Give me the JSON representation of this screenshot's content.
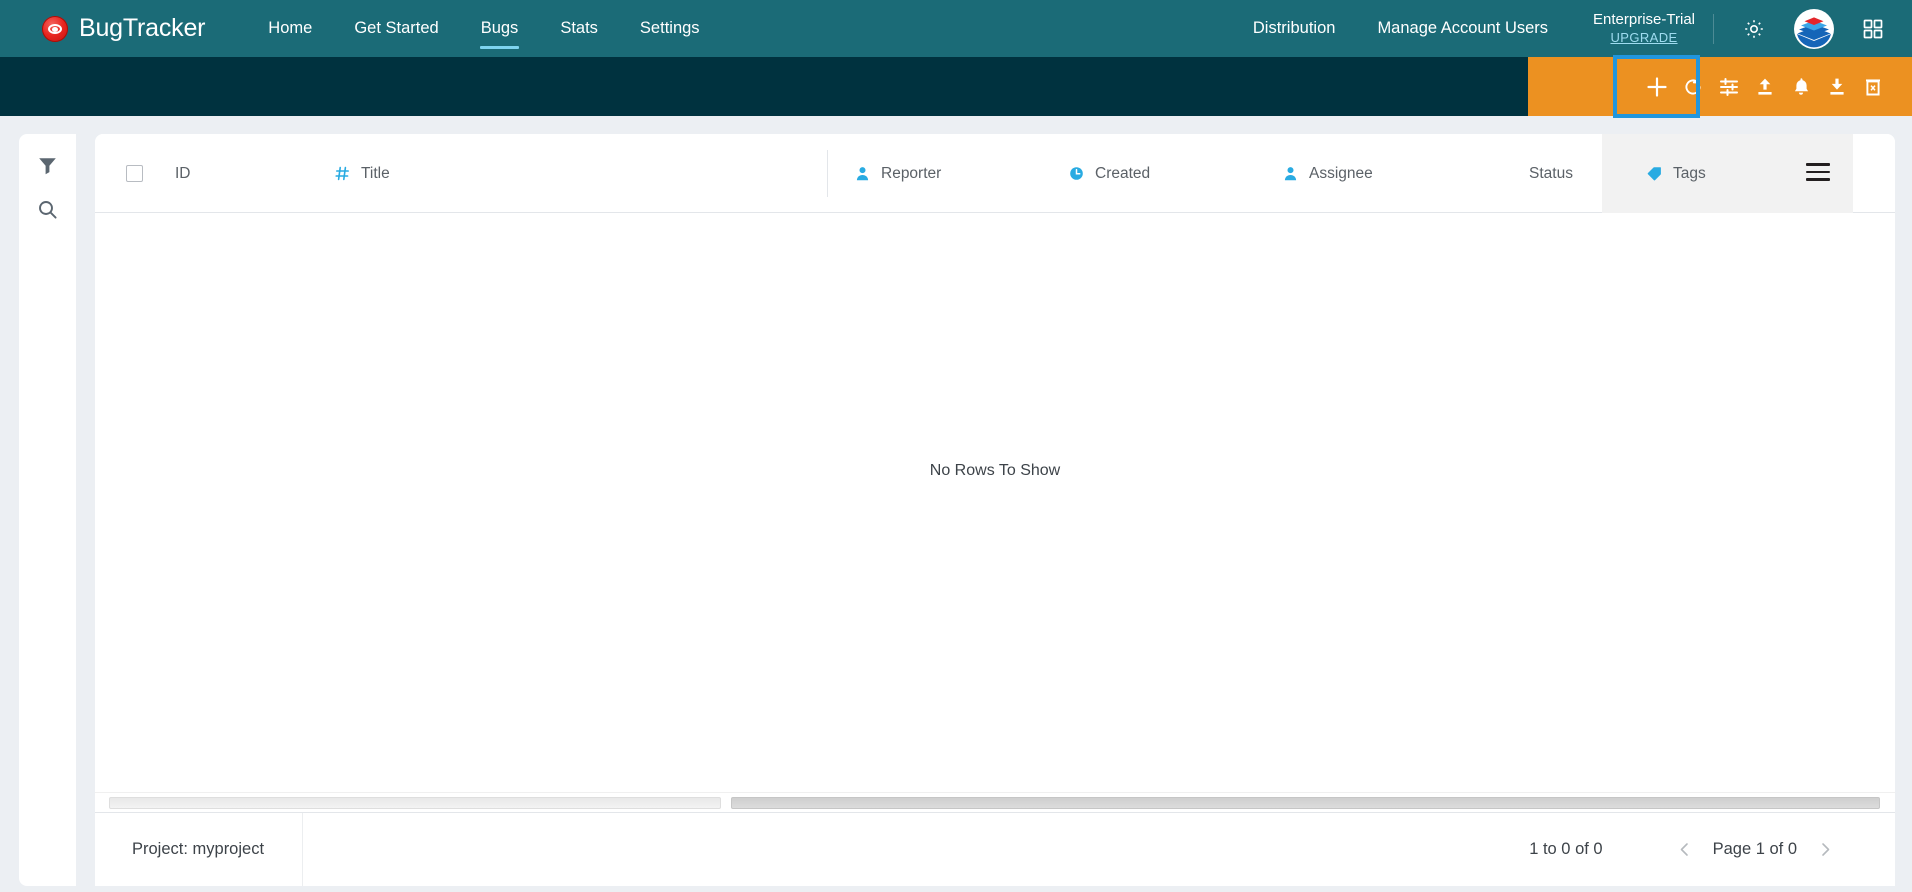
{
  "header": {
    "brand": "BugTracker",
    "logo_icon": "bug-eye-logo",
    "nav": [
      {
        "label": "Home",
        "active": false
      },
      {
        "label": "Get Started",
        "active": false
      },
      {
        "label": "Bugs",
        "active": true
      },
      {
        "label": "Stats",
        "active": false
      },
      {
        "label": "Settings",
        "active": false
      }
    ],
    "nav_right": [
      {
        "label": "Distribution"
      },
      {
        "label": "Manage Account Users"
      }
    ],
    "plan": {
      "name": "Enterprise-Trial",
      "upgrade": "UPGRADE"
    },
    "icons": [
      {
        "name": "gear-icon"
      },
      {
        "name": "stack-diamond-logo-icon"
      },
      {
        "name": "apps-grid-icon"
      }
    ],
    "colors": {
      "nav_bg": "#1b6b77",
      "underline": "#7fd4ef",
      "subbar_bg": "#00323f"
    }
  },
  "toolbar": {
    "bg_color": "#ec9121",
    "highlight_color": "#2196dd",
    "buttons": [
      {
        "name": "add-bug-button",
        "icon": "plus-icon",
        "highlighted": true
      },
      {
        "name": "refresh-button",
        "icon": "refresh-icon",
        "highlighted": false
      },
      {
        "name": "column-settings-button",
        "icon": "sliders-icon",
        "highlighted": false
      },
      {
        "name": "upload-button",
        "icon": "upload-icon",
        "highlighted": false
      },
      {
        "name": "notifications-button",
        "icon": "bell-icon",
        "highlighted": false
      },
      {
        "name": "download-button",
        "icon": "download-icon",
        "highlighted": false
      },
      {
        "name": "delete-button",
        "icon": "trash-icon",
        "highlighted": false
      }
    ]
  },
  "left_rail": {
    "items": [
      {
        "name": "filter-tool",
        "icon": "funnel-icon"
      },
      {
        "name": "search-tool",
        "icon": "search-icon"
      }
    ]
  },
  "grid": {
    "columns": [
      {
        "key": "select",
        "label": "",
        "icon": "checkbox-icon"
      },
      {
        "key": "id",
        "label": "ID",
        "icon": ""
      },
      {
        "key": "title",
        "label": "Title",
        "icon": "hash-icon"
      },
      {
        "key": "reporter",
        "label": "Reporter",
        "icon": "person-icon"
      },
      {
        "key": "created",
        "label": "Created",
        "icon": "clock-icon"
      },
      {
        "key": "assignee",
        "label": "Assignee",
        "icon": "person-icon"
      },
      {
        "key": "status",
        "label": "Status",
        "icon": ""
      },
      {
        "key": "tags",
        "label": "Tags",
        "icon": "tag-icon"
      }
    ],
    "menu_icon": "hamburger-menu-icon",
    "rows": [],
    "empty_message": "No Rows To Show"
  },
  "footer": {
    "project": "Project: myproject",
    "row_count": "1 to 0 of 0",
    "page_label": "Page 1 of 0",
    "prev_icon": "chevron-left-icon",
    "next_icon": "chevron-right-icon"
  }
}
